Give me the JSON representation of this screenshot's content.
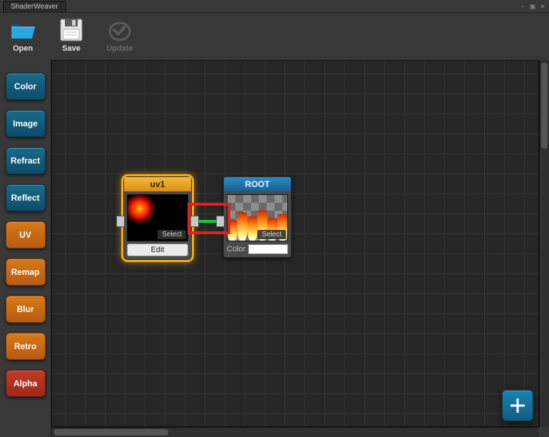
{
  "window": {
    "title": "ShaderWeaver"
  },
  "toolbar": {
    "open": {
      "label": "Open"
    },
    "save": {
      "label": "Save"
    },
    "update": {
      "label": "Update"
    }
  },
  "sidebar": {
    "items": [
      {
        "label": "Color",
        "style": "teal"
      },
      {
        "label": "Image",
        "style": "teal"
      },
      {
        "label": "Refract",
        "style": "teal"
      },
      {
        "label": "Reflect",
        "style": "teal"
      },
      {
        "label": "UV",
        "style": "orange"
      },
      {
        "label": "Remap",
        "style": "orange"
      },
      {
        "label": "Blur",
        "style": "orange"
      },
      {
        "label": "Retro",
        "style": "orange"
      },
      {
        "label": "Alpha",
        "style": "red"
      }
    ]
  },
  "nodes": {
    "uv1": {
      "title": "uv1",
      "select_label": "Select",
      "edit_label": "Edit",
      "selected": true
    },
    "root": {
      "title": "ROOT",
      "select_label": "Select",
      "color_label": "Color",
      "color_value": "#ffffff"
    }
  },
  "add_button": {
    "tooltip": "Add Node"
  }
}
